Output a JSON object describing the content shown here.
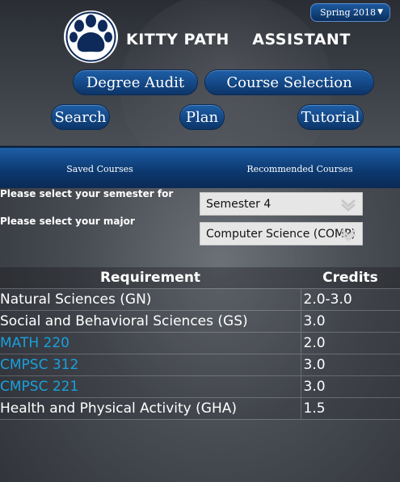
{
  "header": {
    "term": "Spring 2018",
    "title": "KITTY PATH    ASSISTANT"
  },
  "nav": {
    "degree_audit": "Degree Audit",
    "course_selection": "Course Selection",
    "search": "Search",
    "plan": "Plan",
    "tutorial": "Tutorial"
  },
  "subnav": {
    "saved_courses": "Saved Courses",
    "recommended_courses": "Recommended Courses"
  },
  "form": {
    "semester_label": "Please select your semester for",
    "semester_value": "Semester 4",
    "major_label": "Please select your major",
    "major_value": "Computer Science (COMP)"
  },
  "table": {
    "headers": {
      "requirement": "Requirement",
      "credits": "Credits"
    },
    "rows": [
      {
        "requirement": "Natural Sciences (GN)",
        "credits": "2.0-3.0"
      },
      {
        "requirement": "Social and Behavioral Sciences (GS)",
        "credits": "3.0"
      },
      {
        "requirement": "MATH 220",
        "credits": "2.0"
      },
      {
        "requirement": "CMPSC 312",
        "credits": "3.0"
      },
      {
        "requirement": "CMPSC 221",
        "credits": "3.0"
      },
      {
        "requirement": "Health and Physical Activity (GHA)",
        "credits": "1.5"
      }
    ]
  },
  "colors": {
    "button_blue": "#1e5fa8",
    "link_blue": "#1aa0dd",
    "select_bg": "#e6e6e6"
  },
  "icons": {
    "logo": "paw-print-icon",
    "term_caret": "caret-down-icon",
    "select_chevron": "chevron-down-icon"
  }
}
